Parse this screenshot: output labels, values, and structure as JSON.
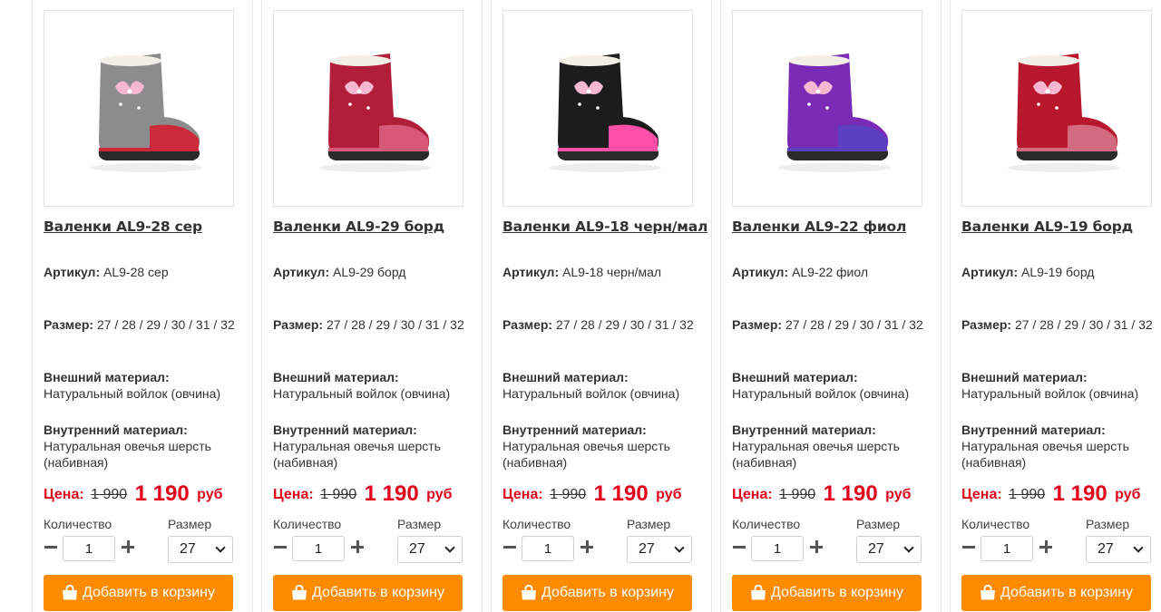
{
  "products": [
    {
      "name": "Валенки AL9-28 сер",
      "article_label": "Артикул:",
      "article": "AL9-28 сер",
      "size_label": "Размер:",
      "sizes": "27 / 28 / 29 / 30 / 31 / 32",
      "outer_label": "Внешний материал:",
      "outer": "Натуральный войлок (овчина)",
      "inner_label": "Внутренний материал:",
      "inner": "Натуральная овечья шерсть (набивная)",
      "price_label": "Цена:",
      "old_price": "1 990",
      "new_price": "1 190",
      "currency": "руб",
      "qty_label": "Количество",
      "qty": "1",
      "size_select_label": "Размер",
      "size_selected": "27",
      "cart_label": "Добавить в корзину",
      "color": "#8c8c8c",
      "accent": "#cc2a3a"
    },
    {
      "name": "Валенки AL9-29 борд",
      "article_label": "Артикул:",
      "article": "AL9-29 борд",
      "size_label": "Размер:",
      "sizes": "27 / 28 / 29 / 30 / 31 / 32",
      "outer_label": "Внешний материал:",
      "outer": "Натуральный войлок (овчина)",
      "inner_label": "Внутренний материал:",
      "inner": "Натуральная овечья шерсть (набивная)",
      "price_label": "Цена:",
      "old_price": "1 990",
      "new_price": "1 190",
      "currency": "руб",
      "qty_label": "Количество",
      "qty": "1",
      "size_select_label": "Размер",
      "size_selected": "27",
      "cart_label": "Добавить в корзину",
      "color": "#b01e3a",
      "accent": "#d8587a"
    },
    {
      "name": "Валенки AL9-18 черн/мал",
      "article_label": "Артикул:",
      "article": "AL9-18 черн/мал",
      "size_label": "Размер:",
      "sizes": "27 / 28 / 29 / 30 / 31 / 32",
      "outer_label": "Внешний материал:",
      "outer": "Натуральный войлок (овчина)",
      "inner_label": "Внутренний материал:",
      "inner": "Натуральная овечья шерсть (набивная)",
      "price_label": "Цена:",
      "old_price": "1 990",
      "new_price": "1 190",
      "currency": "руб",
      "qty_label": "Количество",
      "qty": "1",
      "size_select_label": "Размер",
      "size_selected": "27",
      "cart_label": "Добавить в корзину",
      "color": "#1c1c1c",
      "accent": "#ff4fa8"
    },
    {
      "name": "Валенки AL9-22 фиол",
      "article_label": "Артикул:",
      "article": "AL9-22 фиол",
      "size_label": "Размер:",
      "sizes": "27 / 28 / 29 / 30 / 31 / 32",
      "outer_label": "Внешний материал:",
      "outer": "Натуральный войлок (овчина)",
      "inner_label": "Внутренний материал:",
      "inner": "Натуральная овечья шерсть (набивная)",
      "price_label": "Цена:",
      "old_price": "1 990",
      "new_price": "1 190",
      "currency": "руб",
      "qty_label": "Количество",
      "qty": "1",
      "size_select_label": "Размер",
      "size_selected": "27",
      "cart_label": "Добавить в корзину",
      "color": "#7a2bb5",
      "accent": "#5a3fc0"
    },
    {
      "name": "Валенки AL9-19 борд",
      "article_label": "Артикул:",
      "article": "AL9-19 борд",
      "size_label": "Размер:",
      "sizes": "27 / 28 / 29 / 30 / 31 / 32",
      "outer_label": "Внешний материал:",
      "outer": "Натуральный войлок (овчина)",
      "inner_label": "Внутренний материал:",
      "inner": "Натуральная овечья шерсть (набивная)",
      "price_label": "Цена:",
      "old_price": "1 990",
      "new_price": "1 190",
      "currency": "руб",
      "qty_label": "Количество",
      "qty": "1",
      "size_select_label": "Размер",
      "size_selected": "27",
      "cart_label": "Добавить в корзину",
      "color": "#b8182e",
      "accent": "#d46a80"
    }
  ]
}
